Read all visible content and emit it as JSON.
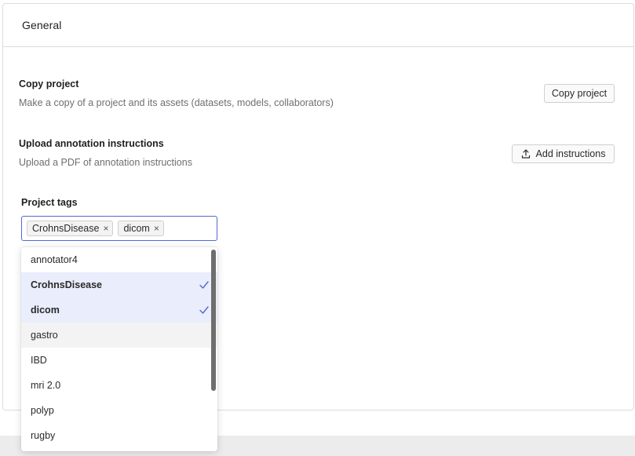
{
  "section": {
    "title": "General"
  },
  "copy_project": {
    "title": "Copy project",
    "description": "Make a copy of a project and its assets (datasets, models, collaborators)",
    "button_label": "Copy project"
  },
  "upload_instructions": {
    "title": "Upload annotation instructions",
    "description": "Upload a PDF of annotation instructions",
    "button_label": "Add instructions",
    "button_icon": "upload-icon"
  },
  "project_tags": {
    "label": "Project tags",
    "selected_tags": [
      "CrohnsDisease",
      "dicom"
    ],
    "remove_icon": "×",
    "options": [
      {
        "label": "annotator4",
        "state": "normal"
      },
      {
        "label": "CrohnsDisease",
        "state": "selected"
      },
      {
        "label": "dicom",
        "state": "selected"
      },
      {
        "label": "gastro",
        "state": "hover"
      },
      {
        "label": "IBD",
        "state": "normal"
      },
      {
        "label": "mri 2.0",
        "state": "normal"
      },
      {
        "label": "polyp",
        "state": "normal"
      },
      {
        "label": "rugby",
        "state": "normal"
      }
    ],
    "check_icon": "check-icon"
  },
  "colors": {
    "accent": "#5468d4",
    "selected_bg": "#e9edfc"
  }
}
